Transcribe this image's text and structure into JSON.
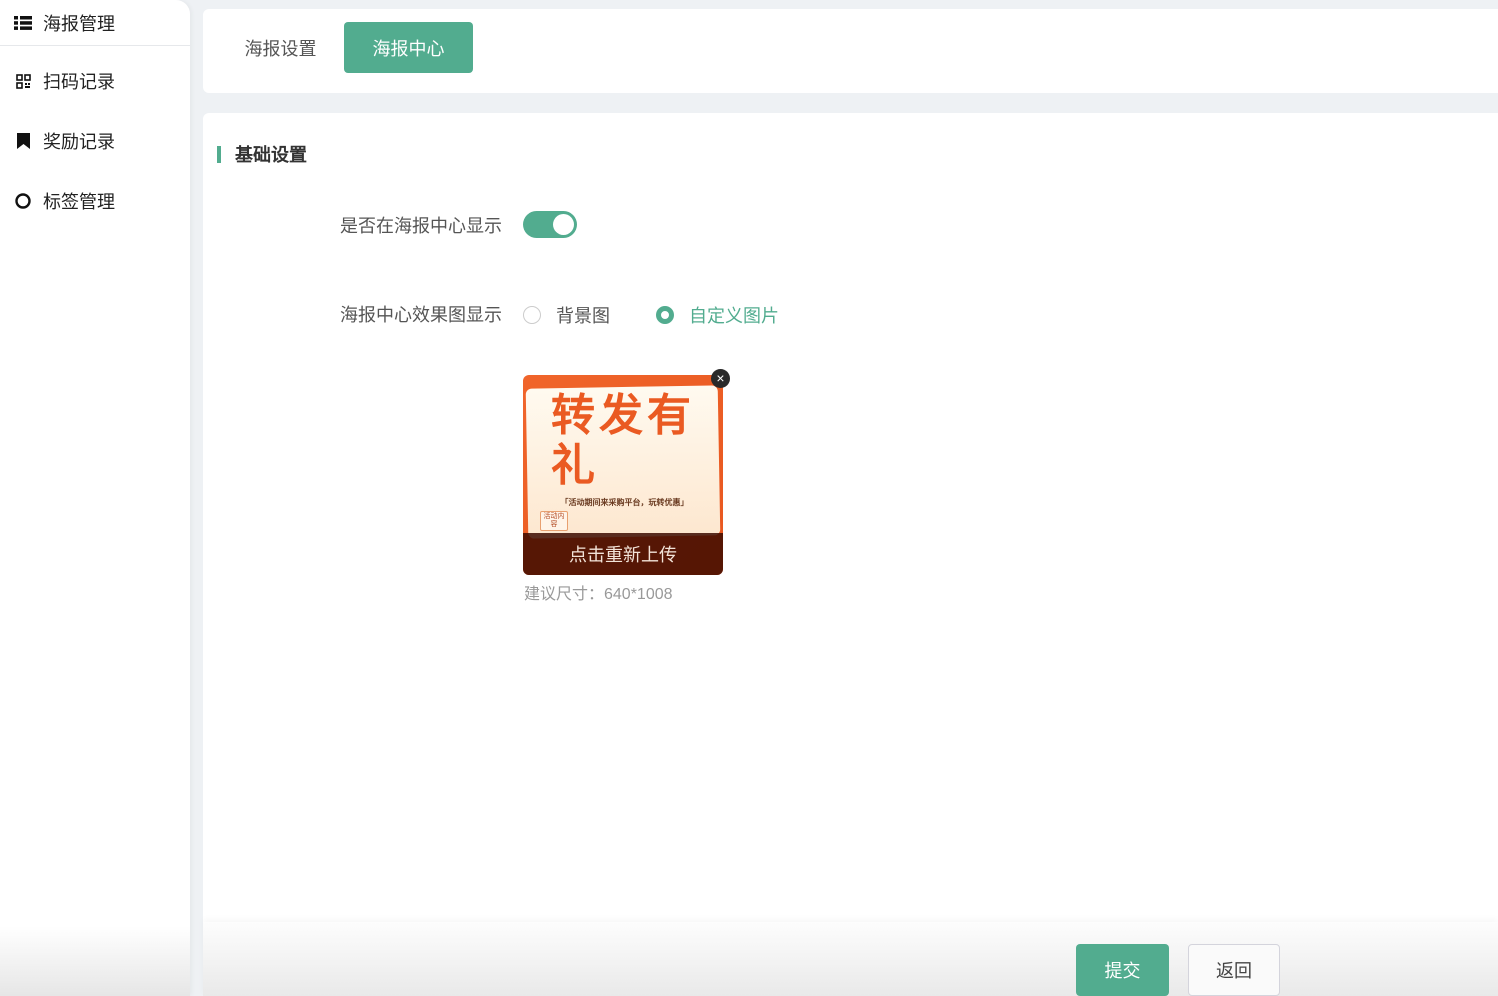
{
  "sidebar": {
    "items": [
      {
        "label": "海报管理",
        "icon": "list-icon"
      },
      {
        "label": "扫码记录",
        "icon": "qrcode-icon"
      },
      {
        "label": "奖励记录",
        "icon": "bookmark-icon"
      },
      {
        "label": "标签管理",
        "icon": "circle-icon"
      }
    ]
  },
  "tabs": [
    {
      "label": "海报设置",
      "active": false
    },
    {
      "label": "海报中心",
      "active": true
    }
  ],
  "section": {
    "title": "基础设置"
  },
  "form": {
    "show_label": "是否在海报中心显示",
    "show_enabled": true,
    "display_label": "海报中心效果图显示",
    "options": [
      {
        "label": "背景图",
        "checked": false
      },
      {
        "label": "自定义图片",
        "checked": true
      }
    ],
    "image": {
      "title_art": "转发有礼",
      "tagline_art": "「活动期间来采购平台，玩转优惠」",
      "badge_art": "活动内容",
      "reupload": "点击重新上传",
      "close": "×"
    },
    "hint": "建议尺寸：640*1008"
  },
  "footer": {
    "submit": "提交",
    "back": "返回"
  },
  "colors": {
    "accent": "#52ac8f"
  }
}
